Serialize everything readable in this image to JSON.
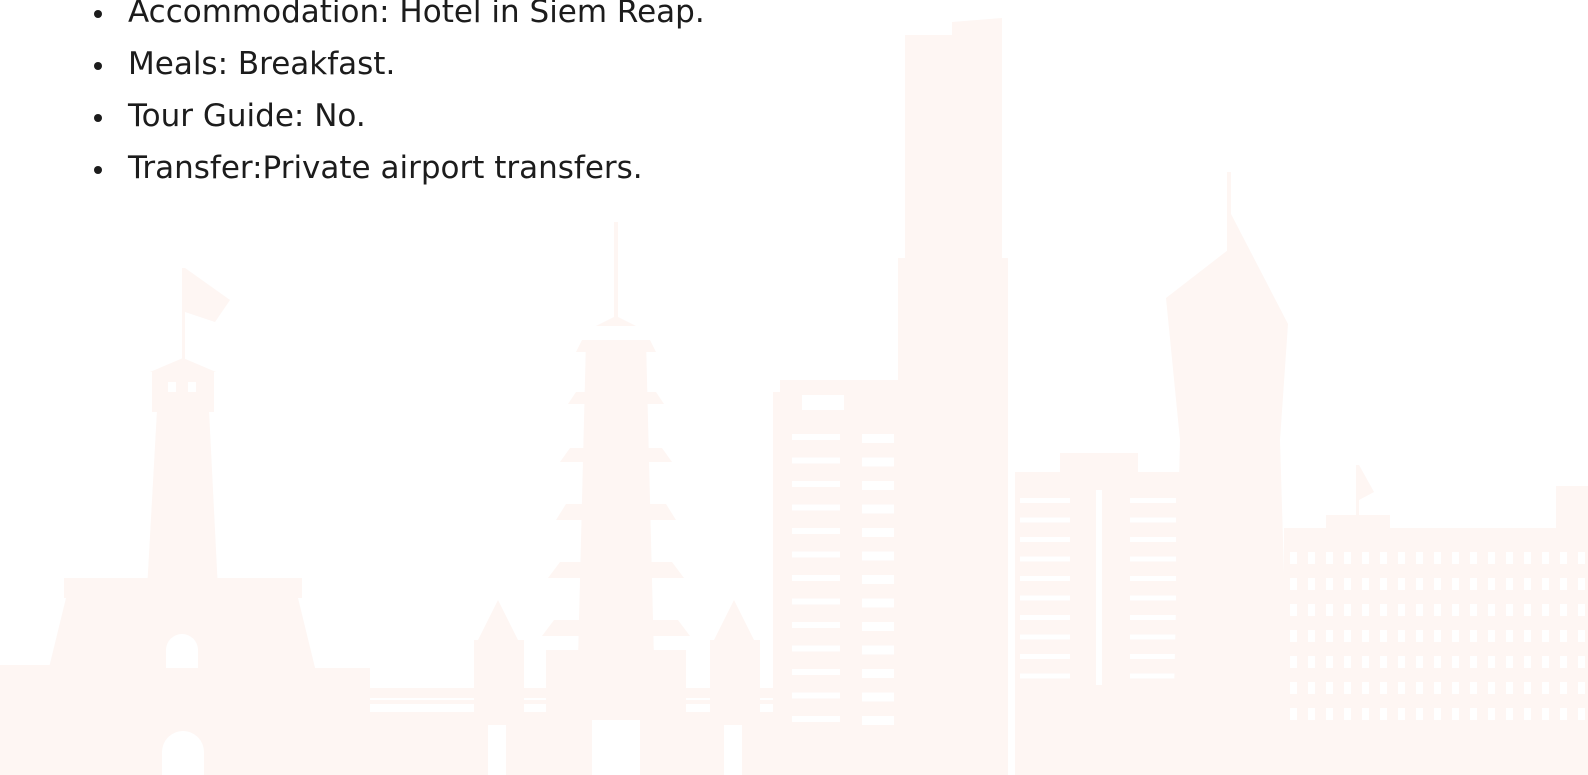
{
  "tour_details": {
    "items": [
      {
        "text": "Accommodation: Hotel in Siem Reap."
      },
      {
        "text": "Meals: Breakfast."
      },
      {
        "text": "Tour Guide: No."
      },
      {
        "text": "Transfer:Private airport transfers."
      }
    ]
  },
  "theme": {
    "text_color": "#1c1c1c",
    "skyline_color": "#fef6f3",
    "background_color": "#ffffff"
  }
}
